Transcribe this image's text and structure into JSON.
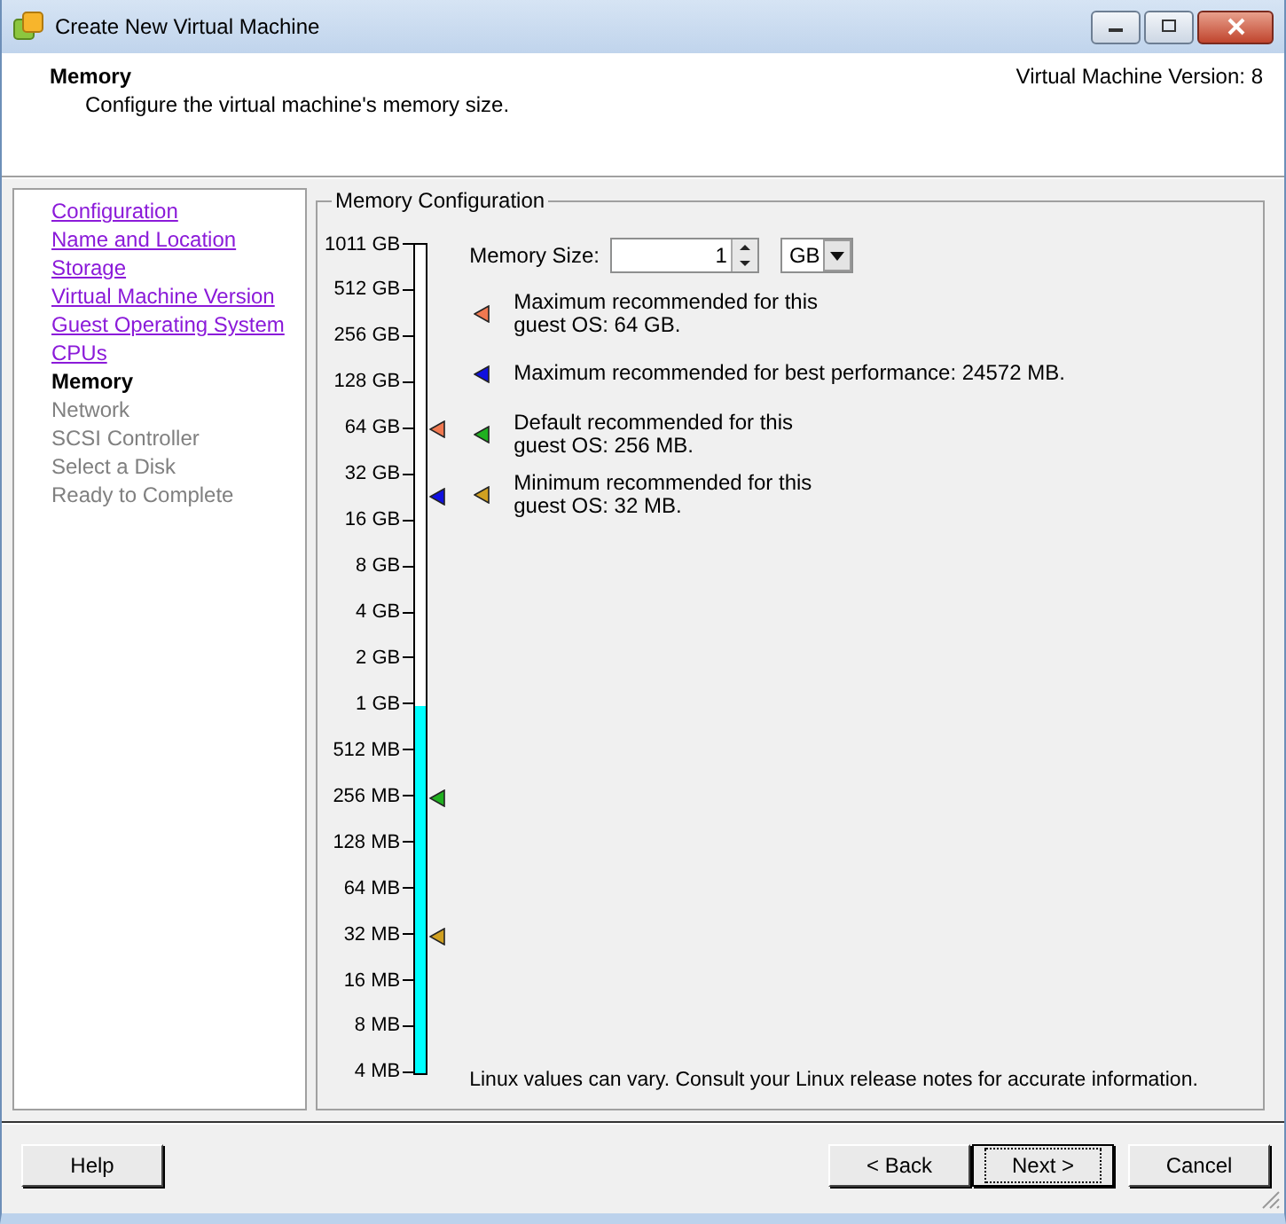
{
  "window": {
    "title": "Create New Virtual Machine"
  },
  "header": {
    "title": "Memory",
    "subtitle": "Configure the virtual machine's memory size.",
    "version": "Virtual Machine Version: 8"
  },
  "steps": [
    {
      "label": "Configuration",
      "kind": "visited",
      "selected": false
    },
    {
      "label": "Name and Location",
      "kind": "visited",
      "selected": false
    },
    {
      "label": "Storage",
      "kind": "visited",
      "selected": false
    },
    {
      "label": "Virtual Machine Version",
      "kind": "visited",
      "selected": false
    },
    {
      "label": "Guest Operating System",
      "kind": "visited",
      "selected": false
    },
    {
      "label": "CPUs",
      "kind": "visited",
      "selected": false
    },
    {
      "label": "Memory",
      "kind": "current",
      "selected": true
    },
    {
      "label": "Network",
      "kind": "pending",
      "selected": false
    },
    {
      "label": "SCSI Controller",
      "kind": "pending",
      "selected": false
    },
    {
      "label": "Select a Disk",
      "kind": "pending",
      "selected": false
    },
    {
      "label": "Ready to Complete",
      "kind": "pending",
      "selected": false
    }
  ],
  "memory_configuration": {
    "title": "Memory Configuration",
    "scale": {
      "ticks": [
        "1011 GB",
        "512 GB",
        "256 GB",
        "128 GB",
        "64 GB",
        "32 GB",
        "16 GB",
        "8 GB",
        "4 GB",
        "2 GB",
        "1 GB",
        "512 MB",
        "256 MB",
        "128 MB",
        "64 MB",
        "32 MB",
        "16 MB",
        "8 MB",
        "4 MB"
      ],
      "level": 0.443,
      "markers": [
        {
          "color": "#f07850",
          "level": 0.777
        },
        {
          "color": "#1010e0",
          "level": 0.696
        },
        {
          "color": "#20b020",
          "level": 0.332
        },
        {
          "color": "#d0a020",
          "level": 0.165
        }
      ]
    },
    "memory_size": {
      "label": "Memory Size:",
      "value": "1",
      "unit": "GB"
    },
    "recommendations": [
      {
        "text": "Maximum recommended for this\nguest OS: 64 GB.",
        "color": "#f07850"
      },
      {
        "text": "Maximum recommended for best performance: 24572 MB.",
        "color": "#1010e0"
      },
      {
        "text": "Default recommended for this\nguest OS: 256 MB.",
        "color": "#20b020"
      },
      {
        "text": "Minimum recommended for this\nguest OS: 32 MB.",
        "color": "#d0a020"
      }
    ],
    "note": "Linux values can vary. Consult your Linux release notes for accurate information."
  },
  "buttons": [
    {
      "label": "Help",
      "kind": "help",
      "focused": false
    },
    {
      "label": "< Back",
      "kind": "nav",
      "focused": false
    },
    {
      "label": "Next >",
      "kind": "nav",
      "focused": true
    },
    {
      "label": "Cancel",
      "kind": "cancel",
      "focused": false
    }
  ]
}
